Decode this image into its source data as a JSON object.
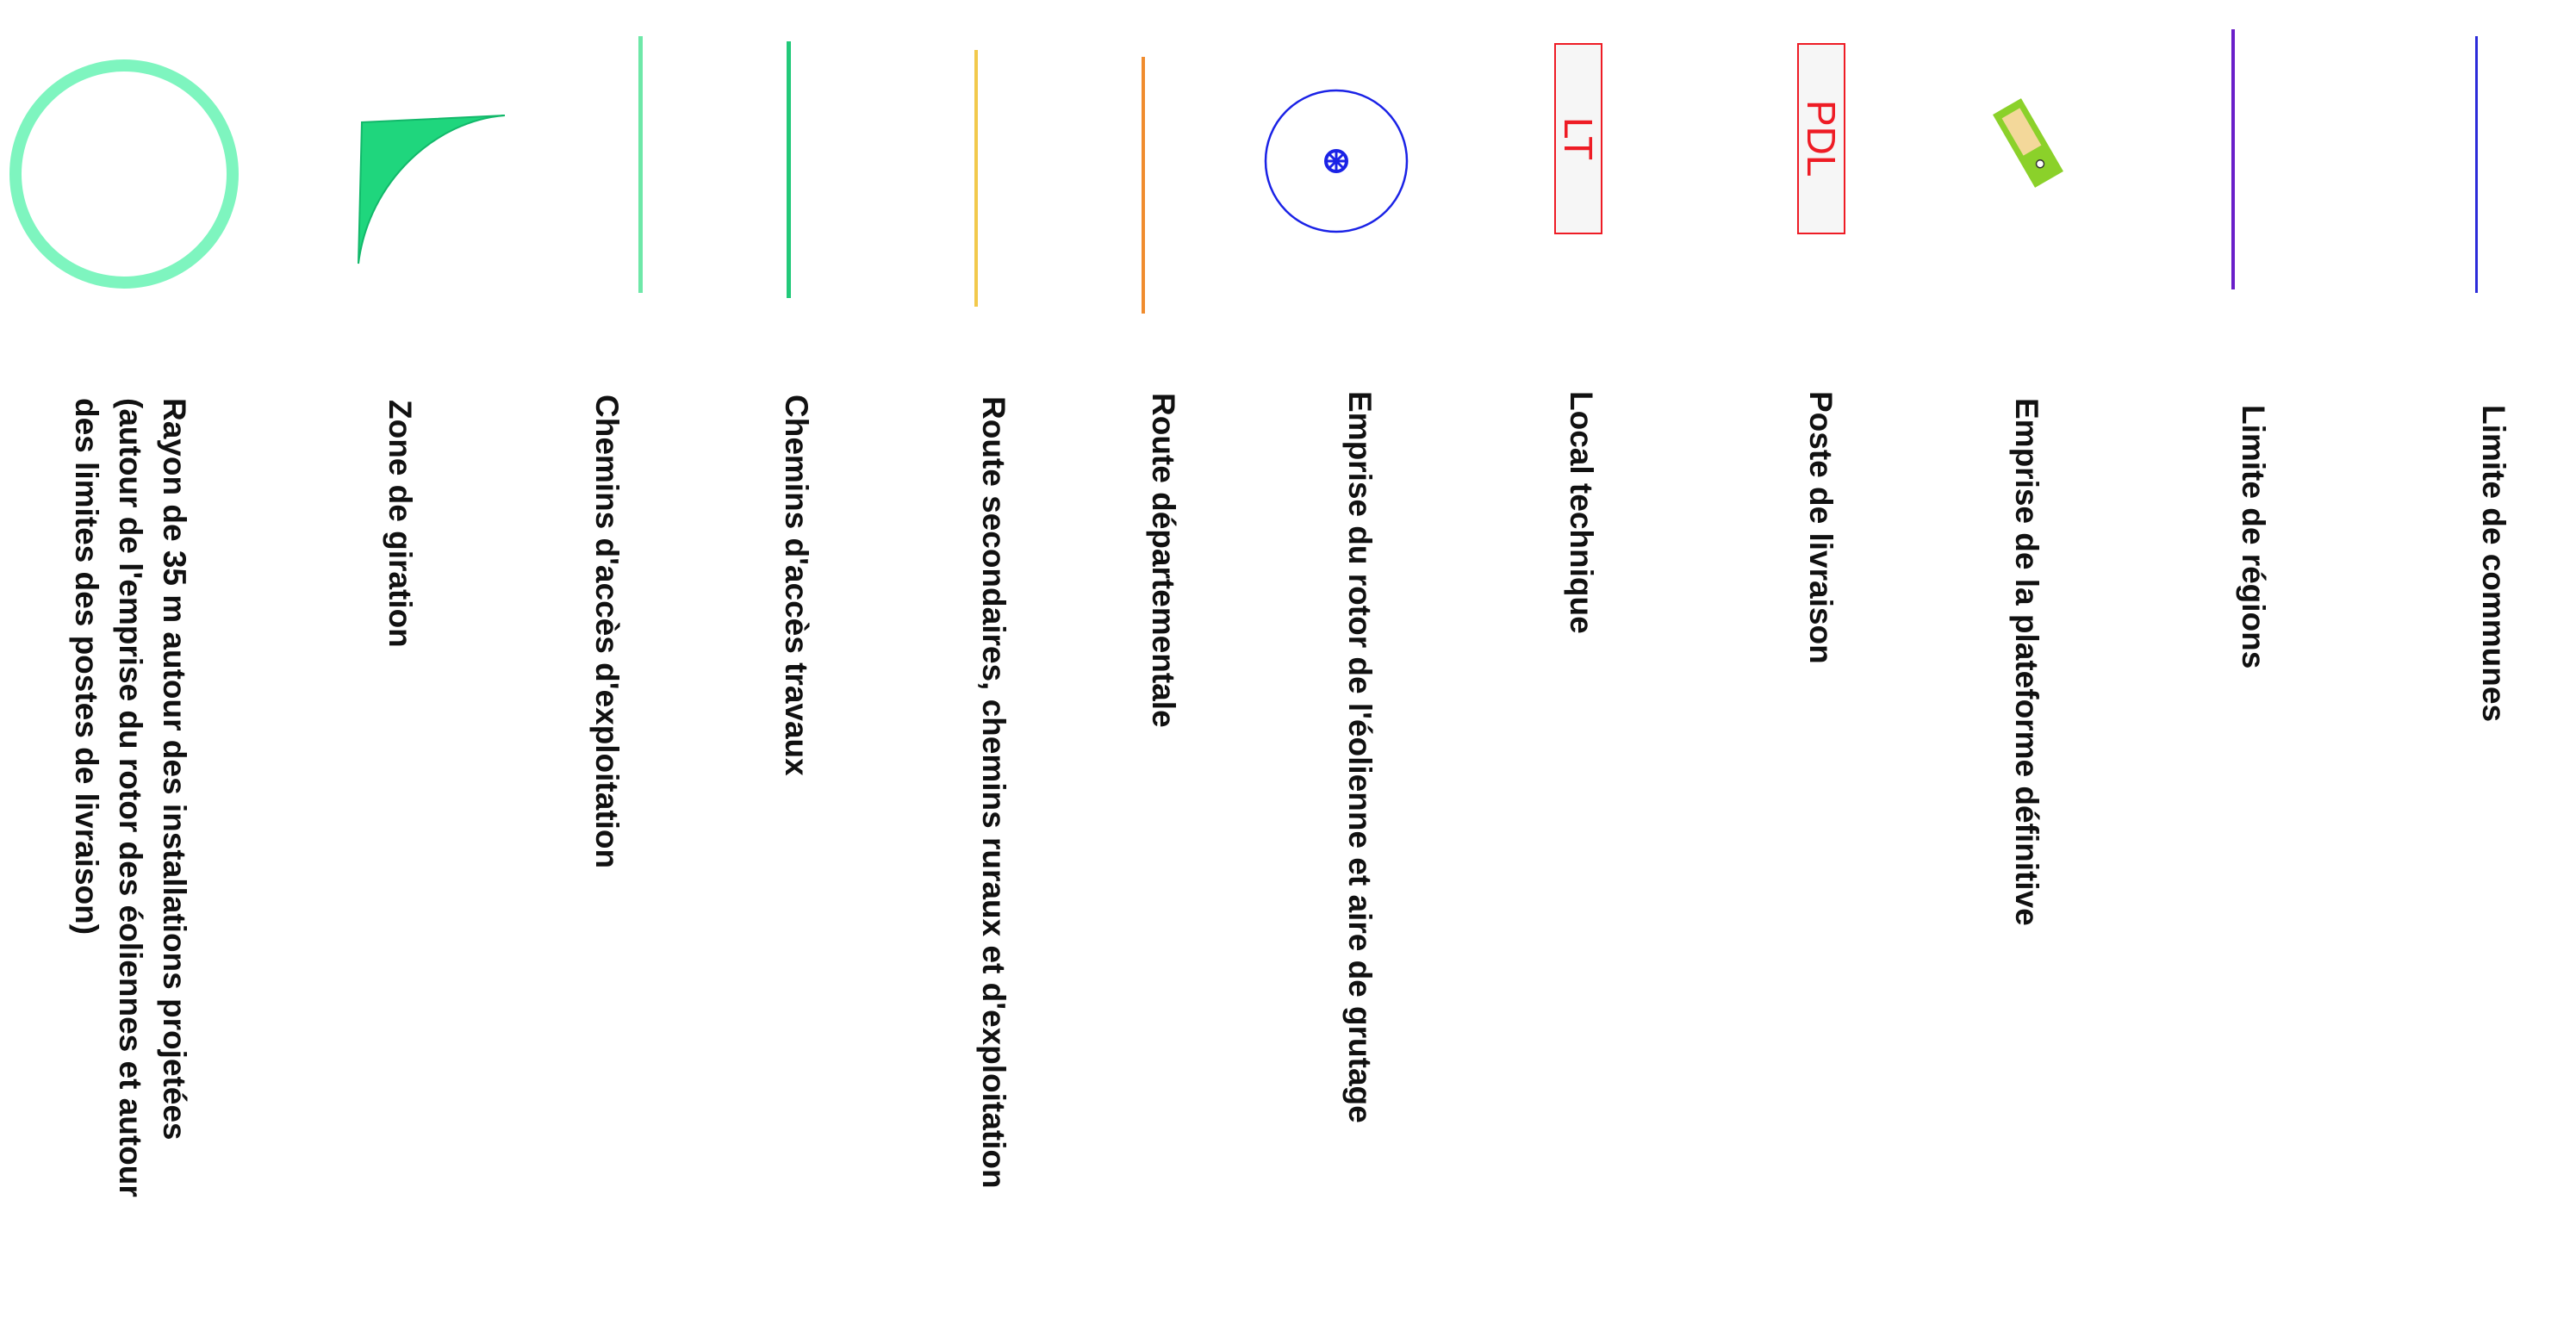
{
  "legend": {
    "items": [
      {
        "id": "rayon",
        "label_lines": [
          "Rayon de 35 m autour des installations projetées",
          "(autour de l'emprise du rotor des éoliennes et autour",
          "des limites des postes de livraison)"
        ],
        "symbol": "ring-outline",
        "color": "#7ef5bf"
      },
      {
        "id": "giration",
        "label": "Zone de giration",
        "symbol": "giration-zone-shape",
        "color": "#1fd67d"
      },
      {
        "id": "chemins-exploitation",
        "label": "Chemins d'accès d'exploitation",
        "symbol": "line",
        "color": "#6ee8a8"
      },
      {
        "id": "chemins-travaux",
        "label": "Chemins d'accès travaux",
        "symbol": "line",
        "color": "#22c97a"
      },
      {
        "id": "route-secondaire",
        "label": "Route secondaires, chemins ruraux et d'exploitation",
        "symbol": "line",
        "color": "#f2c94c"
      },
      {
        "id": "route-departementale",
        "label": "Route départementale",
        "symbol": "line",
        "color": "#f08c2e"
      },
      {
        "id": "rotor",
        "label": "Emprise du rotor de l'éolienne et aire de grutage",
        "symbol": "rotor-circle",
        "color": "#1a22e6"
      },
      {
        "id": "local-technique",
        "label": "Local technique",
        "symbol": "box-label",
        "box_text": "LT",
        "color": "#ee1c25"
      },
      {
        "id": "poste-livraison",
        "label": "Poste de livraison",
        "symbol": "box-label",
        "box_text": "PDL",
        "color": "#ee1c25"
      },
      {
        "id": "plateforme",
        "label": "Emprise de la plateforme définitive",
        "symbol": "platform-rectangle",
        "color": "#8bd12a"
      },
      {
        "id": "limite-regions",
        "label": "Limite de régions",
        "symbol": "line",
        "color": "#6a1fc9"
      },
      {
        "id": "limite-communes",
        "label": "Limite de communes",
        "symbol": "line",
        "color": "#2b2bd9"
      }
    ]
  }
}
